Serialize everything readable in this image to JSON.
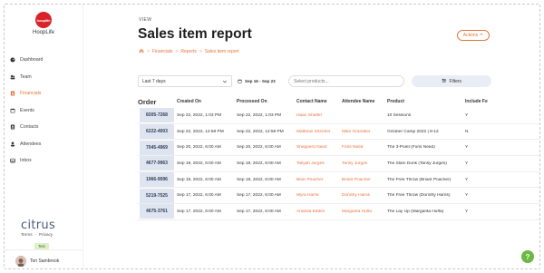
{
  "sidebar": {
    "logo_badge": "hooplife",
    "app_name": "HoopLife",
    "items": [
      {
        "label": "Dashboard",
        "icon": "dashboard-icon",
        "active": false
      },
      {
        "label": "Team",
        "icon": "team-icon",
        "active": false
      },
      {
        "label": "Financials",
        "icon": "financials-icon",
        "active": true
      },
      {
        "label": "Events",
        "icon": "events-icon",
        "active": false
      },
      {
        "label": "Contacts",
        "icon": "contacts-icon",
        "active": false
      },
      {
        "label": "Attendees",
        "icon": "attendees-icon",
        "active": false
      },
      {
        "label": "Inbox",
        "icon": "inbox-icon",
        "active": false
      }
    ],
    "brand": "citrus",
    "terms": "Terms",
    "dot": "·",
    "privacy": "Privacy",
    "test_badge": "Test",
    "user_name": "Tori Sambrook"
  },
  "header": {
    "view_label": "VIEW",
    "title": "Sales item report",
    "breadcrumb": [
      "Financials",
      "Reports",
      "Sales item report"
    ],
    "actions_label": "Actions"
  },
  "filters": {
    "period": "Last 7 days",
    "date_range": "Sep 16 - Sep 23",
    "search_placeholder": "Select products...",
    "filters_label": "Filters"
  },
  "table": {
    "columns": [
      "Order",
      "Created On",
      "Processed On",
      "Contact Name",
      "Attendee Name",
      "Product",
      "Include Fe"
    ],
    "rows": [
      {
        "order": "8305-7268",
        "created": "Sep 22, 2022, 1:03 PM",
        "processed": "Sep 22, 2022, 1:03 PM",
        "contact": "Isaac Shaffer",
        "attendee": "",
        "product": "10 Sessions",
        "include": "Y"
      },
      {
        "order": "6222-4003",
        "created": "Sep 22, 2022, 12:58 PM",
        "processed": "Sep 22, 2022, 12:58 PM",
        "contact": "Matthew Shenher",
        "attendee": "Mike Granatier",
        "product": "October Camp 2022 | 8-12",
        "include": "N"
      },
      {
        "order": "7045-4969",
        "created": "Sep 20, 2022, 6:00 AM",
        "processed": "Sep 20, 2022, 6:00 AM",
        "contact": "Shepperd Need",
        "attendee": "Fons Need",
        "product": "The 3-Point (Fons Need)",
        "include": "Y"
      },
      {
        "order": "4677-9963",
        "created": "Sep 19, 2022, 6:00 AM",
        "processed": "Sep 19, 2022, 6:00 AM",
        "contact": "Taliyah Jurges",
        "attendee": "Tansy Jurges",
        "product": "The Slam Dunk (Tansy Jurges)",
        "include": "Y"
      },
      {
        "order": "1966-9096",
        "created": "Sep 18, 2022, 6:00 AM",
        "processed": "Sep 18, 2022, 6:00 AM",
        "contact": "Bear Poacher",
        "attendee": "Briant Poacher",
        "product": "The Free Throw (Briant Poacher)",
        "include": "Y"
      },
      {
        "order": "5219-7525",
        "created": "Sep 17, 2022, 6:00 AM",
        "processed": "Sep 17, 2022, 6:00 AM",
        "contact": "Myra Harris",
        "attendee": "Dorothy Harris",
        "product": "The Free Throw (Dorothy Harris)",
        "include": "Y"
      },
      {
        "order": "4675-3761",
        "created": "Sep 17, 2022, 6:00 AM",
        "processed": "Sep 17, 2022, 6:00 AM",
        "contact": "Anatola Edden",
        "attendee": "Margarita Huffa",
        "product": "The Lay Up (Margarita Huffa)",
        "include": "Y"
      }
    ]
  },
  "help_label": "?",
  "colors": {
    "accent": "#e8743b",
    "order_bg": "#dee5f0",
    "logo_red": "#d9222a",
    "help_green": "#6bb843"
  }
}
